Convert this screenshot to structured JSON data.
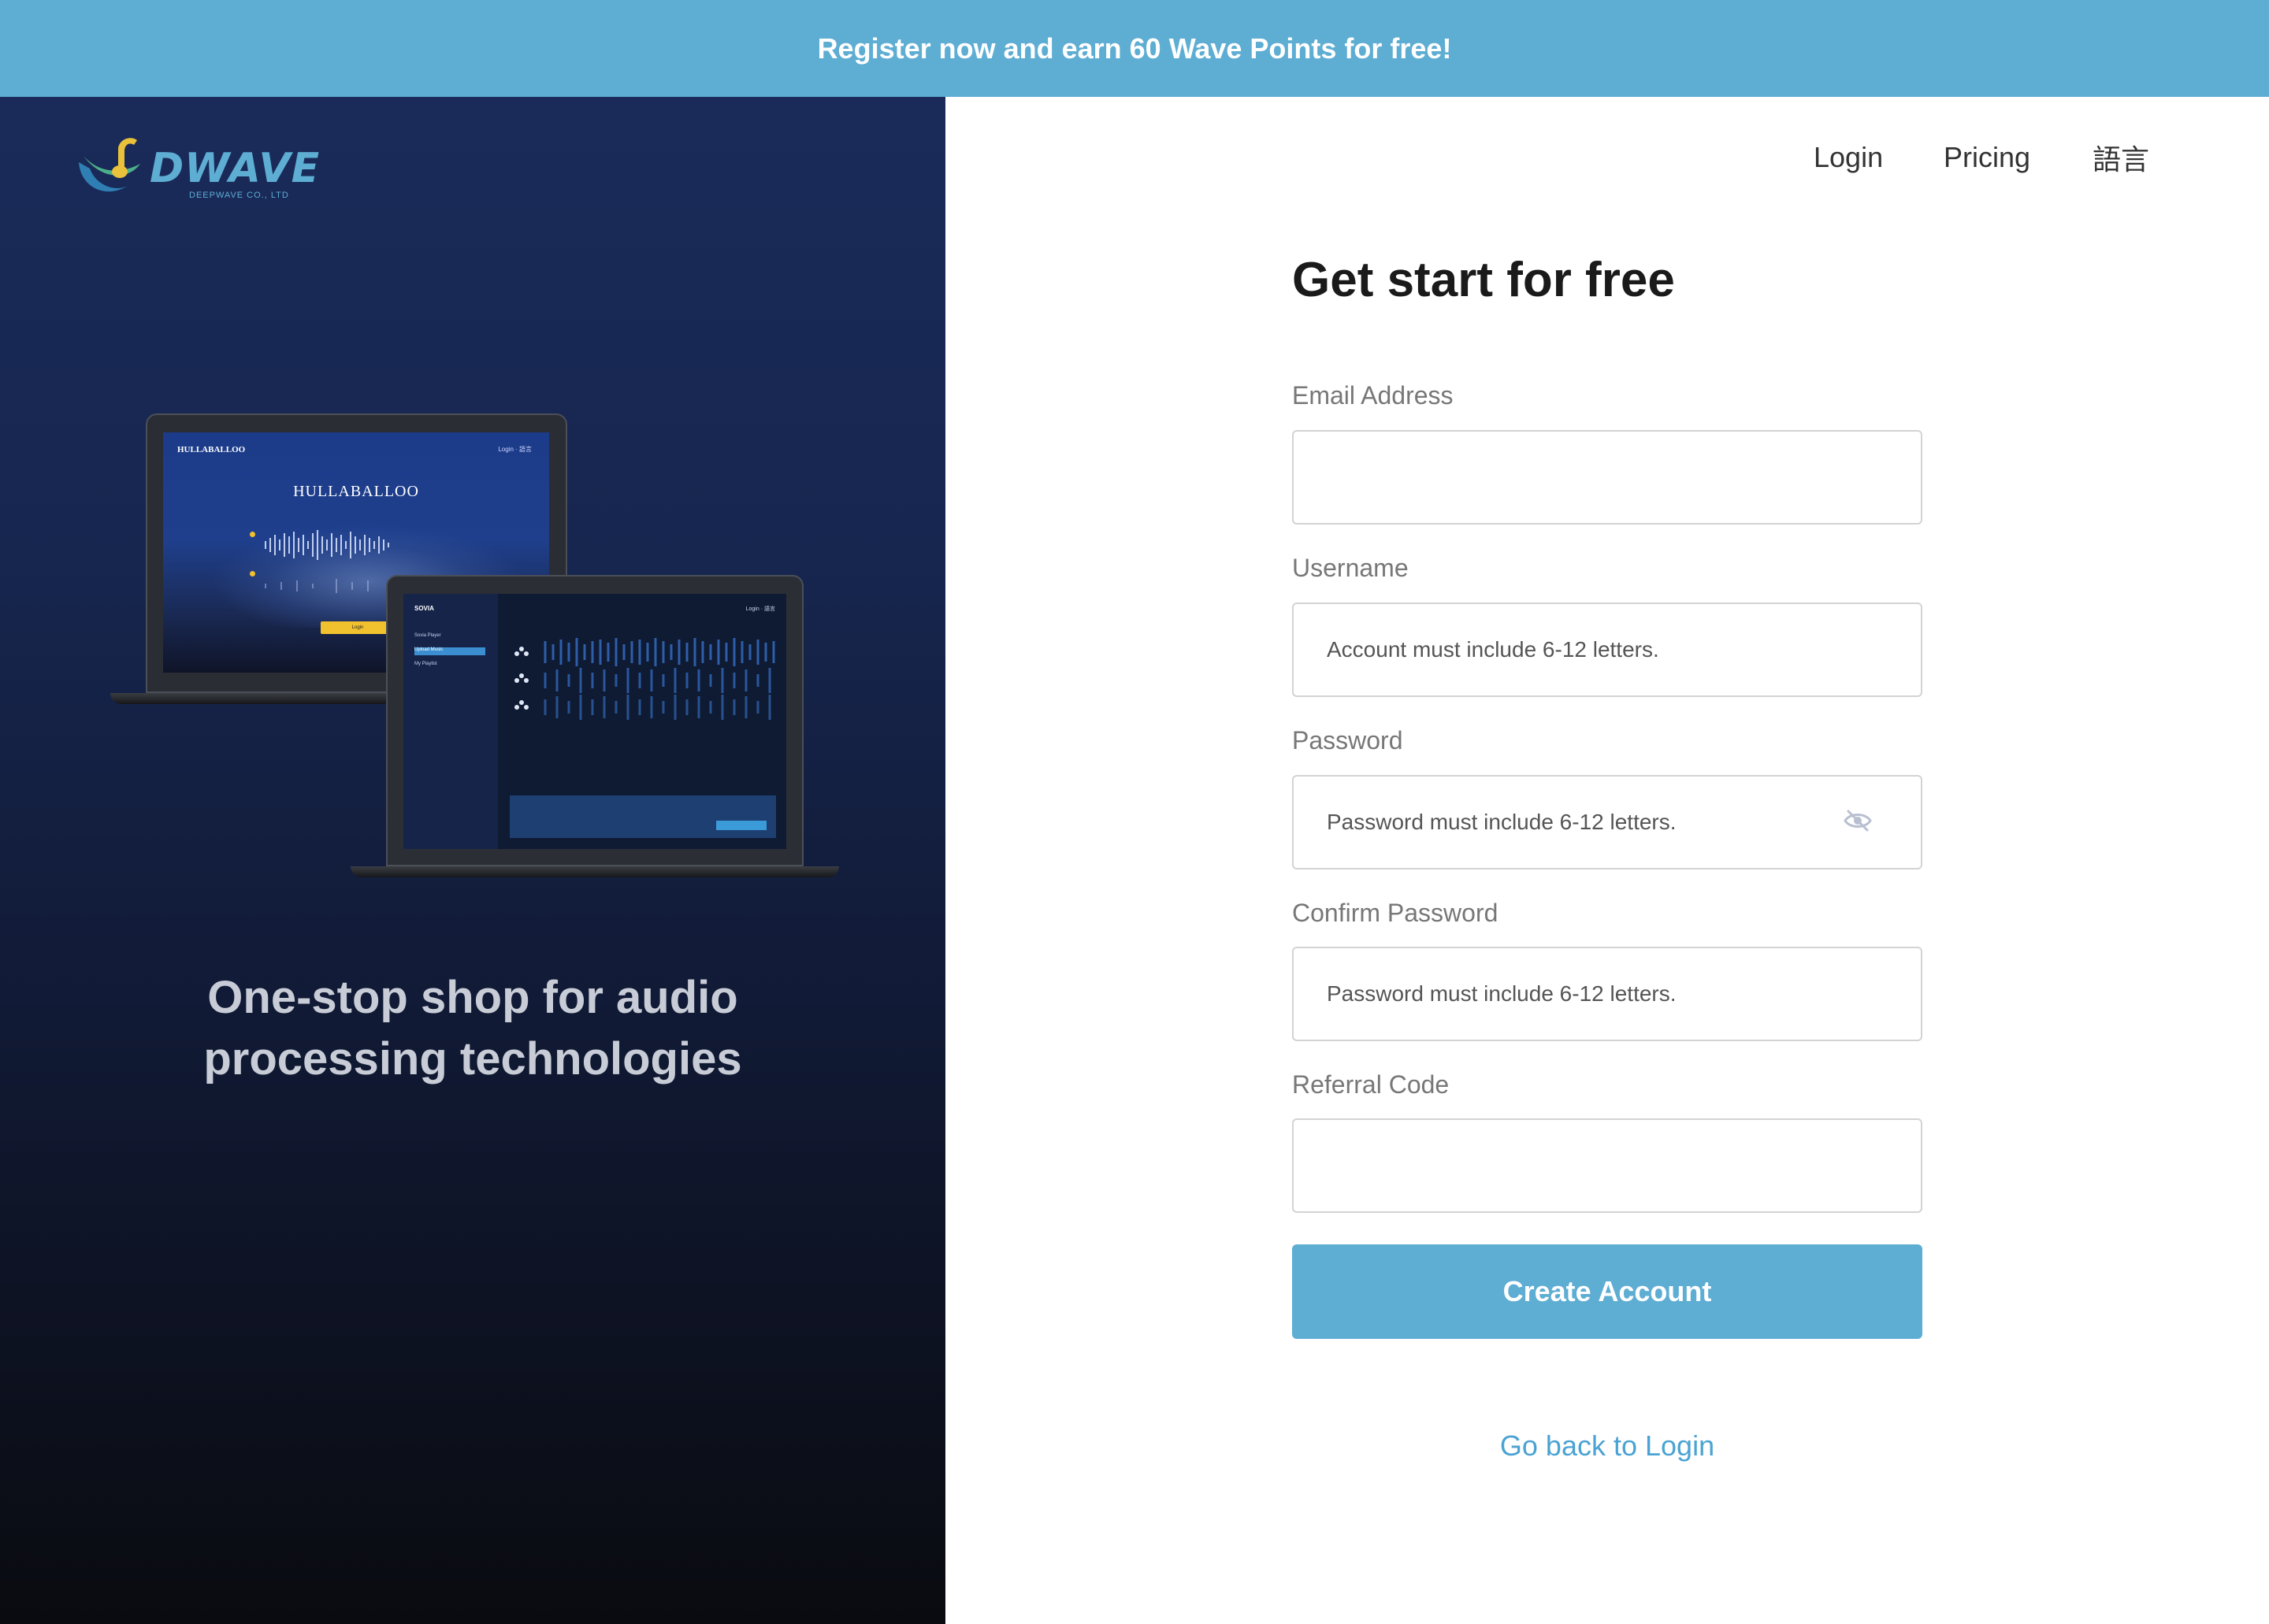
{
  "banner": {
    "text": "Register now and earn 60 Wave Points for free!"
  },
  "brand": {
    "logo_text": "DWAVE",
    "logo_subtext": "DEEPWAVE CO., LTD",
    "colors": {
      "accent": "#5eadd3",
      "logo_yellow": "#e9c13a"
    }
  },
  "hero": {
    "tagline_line1": "One-stop shop for audio",
    "tagline_line2": "processing technologies",
    "mockup_back": {
      "brand": "HULLABALLOO",
      "title": "HULLABALLOO",
      "nav_login": "Login",
      "nav_lang": "語言"
    },
    "mockup_front": {
      "brand": "SOVIA",
      "sidebar_items": [
        "Sovia Player",
        "Upload Music",
        "My Playlist"
      ],
      "nav_login": "Login",
      "nav_lang": "語言"
    }
  },
  "nav": {
    "login": "Login",
    "pricing": "Pricing",
    "language": "語言"
  },
  "form": {
    "title": "Get start for free",
    "email_label": "Email Address",
    "email_value": "",
    "email_placeholder": "",
    "username_label": "Username",
    "username_placeholder": "Account must include 6-12 letters.",
    "password_label": "Password",
    "password_placeholder": "Password must include 6-12 letters.",
    "confirm_label": "Confirm Password",
    "confirm_placeholder": "Password must include 6-12 letters.",
    "referral_label": "Referral Code",
    "referral_placeholder": "",
    "submit_label": "Create Account",
    "back_link": "Go back to Login",
    "password_visibility_icon": "eye-off-icon"
  }
}
